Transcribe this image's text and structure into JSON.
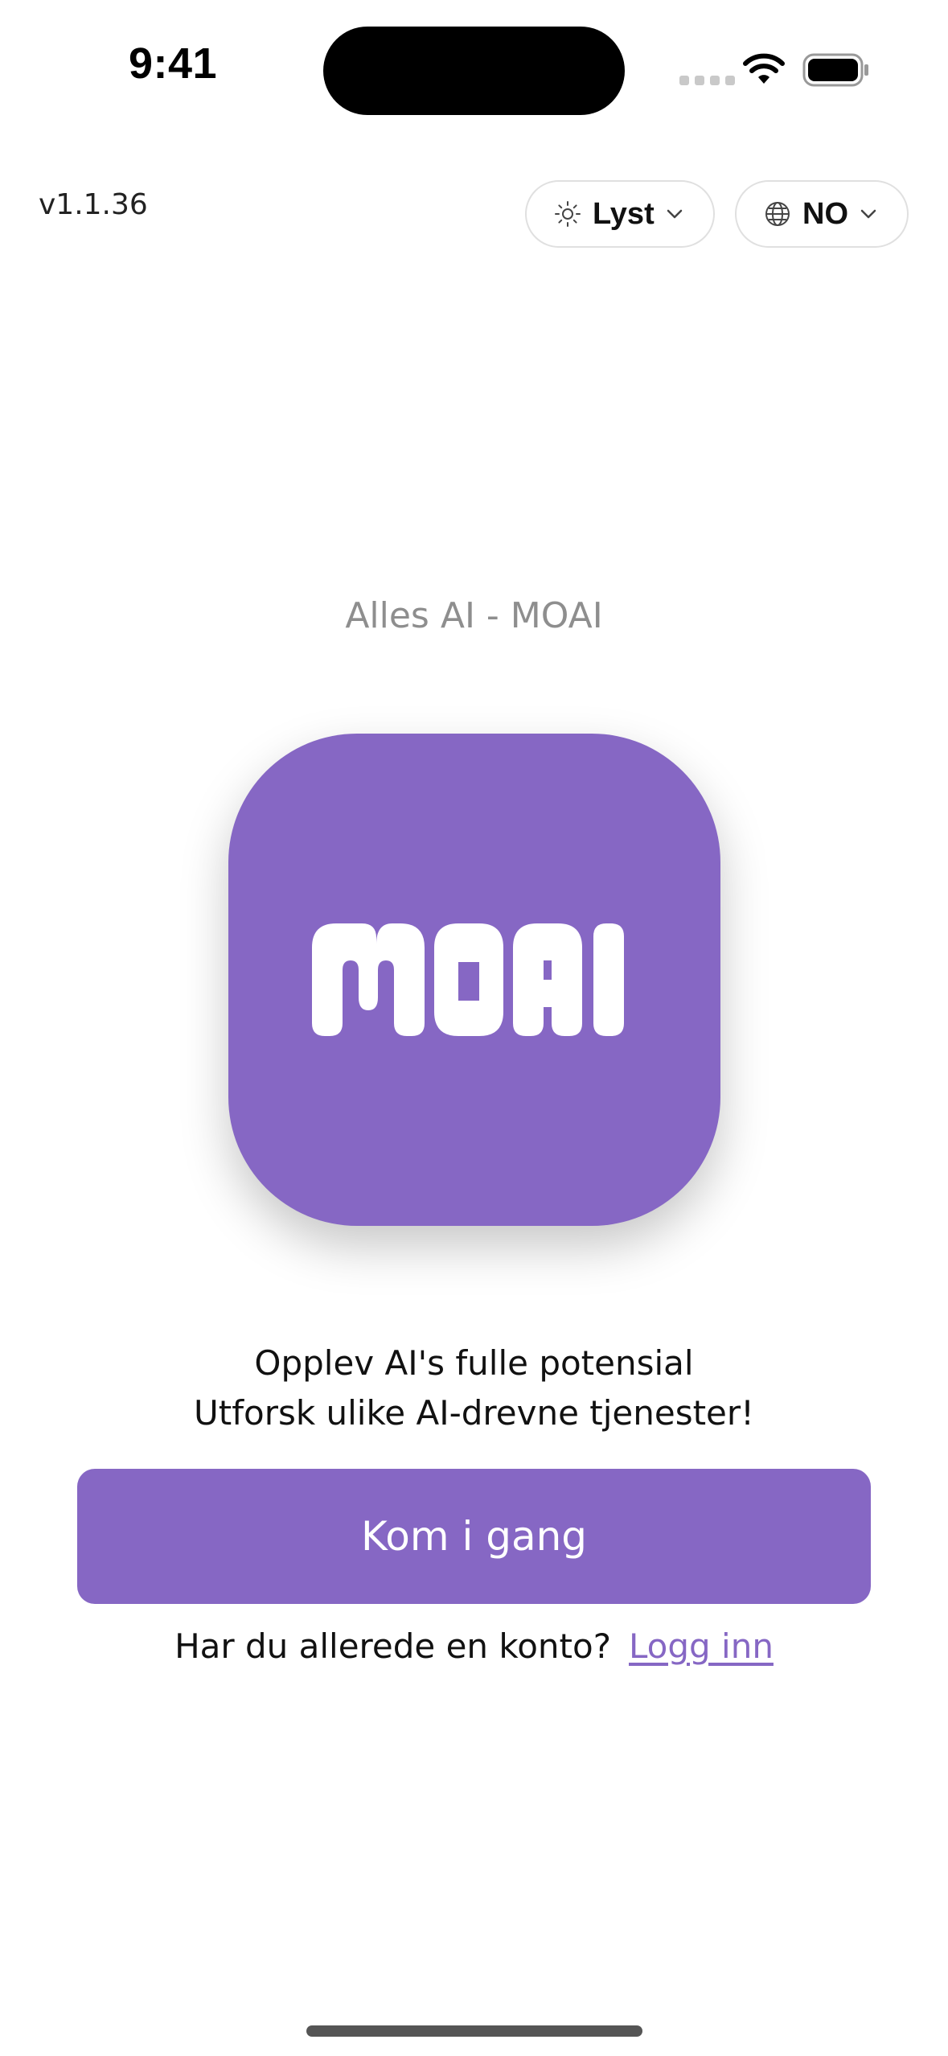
{
  "status_bar": {
    "time": "9:41"
  },
  "header": {
    "version": "v1.1.36",
    "theme_selector": {
      "label": "Lyst",
      "icon": "sun-icon"
    },
    "language_selector": {
      "label": "NO",
      "icon": "globe-icon"
    }
  },
  "main": {
    "app_name": "Alles AI - MOAI",
    "logo": {
      "text": "MOAI",
      "color": "#8667c4"
    },
    "tagline_line1": "Opplev AI's fulle potensial",
    "tagline_line2": "Utforsk ulike AI-drevne tjenester!",
    "cta_label": "Kom i gang",
    "login_prompt": "Har du allerede en konto?",
    "login_link": "Logg inn"
  },
  "colors": {
    "accent": "#8667c4",
    "muted_text": "#8e8e8e"
  }
}
